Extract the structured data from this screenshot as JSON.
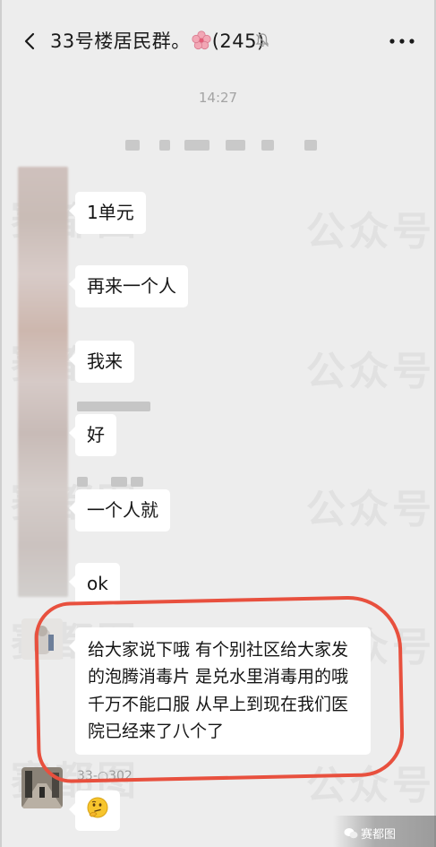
{
  "header": {
    "title_prefix": "33号楼居民群。",
    "member_count": "(245)",
    "icons": {
      "back": "chevron-left-icon",
      "flower": "cherry-blossom-icon",
      "mute": "bell-off-icon",
      "more": "more-dots-icon"
    }
  },
  "chat": {
    "timestamp": "14:27",
    "messages": [
      {
        "text": "1单元"
      },
      {
        "text": "再来一个人"
      },
      {
        "text": "我来"
      },
      {
        "text": "好"
      },
      {
        "text": "一个人就"
      },
      {
        "text": "ok"
      },
      {
        "text": "给大家说下哦  有个别社区给大家发的泡腾消毒片  是兑水里消毒用的哦   千万不能口服   从早上到现在我们医院已经来了八个了"
      },
      {
        "sender": "33-○302",
        "emoji": "thinking-face-icon"
      }
    ]
  },
  "watermarks": [
    "赛都图",
    "公众号"
  ],
  "corner_logo": "赛都图",
  "colors": {
    "background": "#ededed",
    "bubble": "#ffffff",
    "highlight": "#e8503e"
  }
}
